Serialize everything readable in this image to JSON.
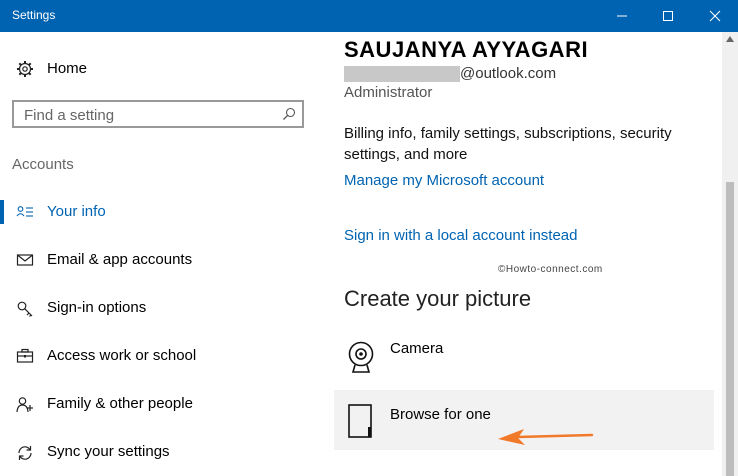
{
  "window": {
    "title": "Settings"
  },
  "sidebar": {
    "home_label": "Home",
    "search_placeholder": "Find a setting",
    "section_label": "Accounts",
    "items": [
      {
        "label": "Your info",
        "icon": "person-card-icon",
        "active": true
      },
      {
        "label": "Email & app accounts",
        "icon": "mail-icon"
      },
      {
        "label": "Sign-in options",
        "icon": "key-icon"
      },
      {
        "label": "Access work or school",
        "icon": "briefcase-icon"
      },
      {
        "label": "Family & other people",
        "icon": "people-icon"
      },
      {
        "label": "Sync your settings",
        "icon": "sync-icon"
      }
    ]
  },
  "content": {
    "user_name": "SAUJANYA AYYAGARI",
    "email_domain": "@outlook.com",
    "role": "Administrator",
    "billing_text": "Billing info, family settings, subscriptions, security settings, and more",
    "manage_link": "Manage my Microsoft account",
    "signin_link": "Sign in with a local account instead",
    "watermark": "©Howto-connect.com",
    "section_title": "Create your picture",
    "options": [
      {
        "label": "Camera",
        "icon": "camera-icon"
      },
      {
        "label": "Browse for one",
        "icon": "file-icon"
      }
    ]
  },
  "colors": {
    "accent": "#0063b1",
    "arrow": "#f07a2a"
  }
}
